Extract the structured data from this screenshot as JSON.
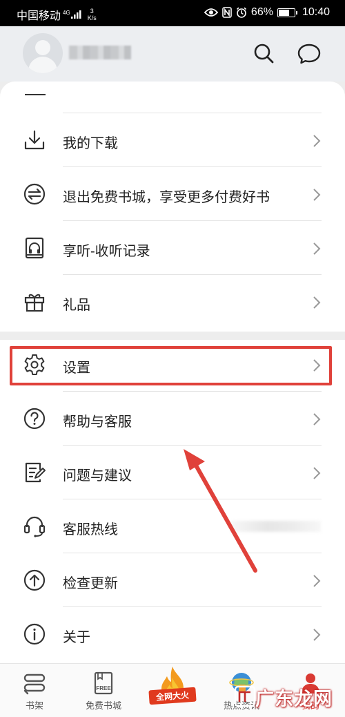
{
  "status_bar": {
    "carrier": "中国移动",
    "network": "4G",
    "speed_value": "3",
    "speed_unit": "K/s",
    "battery": "66%",
    "time": "10:40"
  },
  "header": {
    "icons": [
      "search-icon",
      "message-icon"
    ]
  },
  "menu": {
    "items": [
      {
        "label": "我的下载",
        "icon": "download-icon"
      },
      {
        "label": "退出免费书城，享受更多付费好书",
        "icon": "exchange-icon"
      },
      {
        "label": "享听-收听记录",
        "icon": "audiobook-icon"
      },
      {
        "label": "礼品",
        "icon": "gift-icon"
      },
      {
        "label": "设置",
        "icon": "gear-icon"
      },
      {
        "label": "帮助与客服",
        "icon": "help-icon"
      },
      {
        "label": "问题与建议",
        "icon": "feedback-icon"
      },
      {
        "label": "客服热线",
        "icon": "headset-icon"
      },
      {
        "label": "检查更新",
        "icon": "update-icon"
      },
      {
        "label": "关于",
        "icon": "info-icon"
      }
    ]
  },
  "bottom_nav": {
    "items": [
      {
        "label": "书架",
        "icon": "bookshelf-icon"
      },
      {
        "label": "免费书城",
        "icon": "free-book-icon",
        "icon_text": "FREE"
      },
      {
        "label": "",
        "icon": "fire-promo-icon",
        "promo_text": "全网大火"
      },
      {
        "label": "热点资讯",
        "icon": "globe-news-icon"
      },
      {
        "label": "我的",
        "icon": "profile-icon"
      }
    ]
  },
  "annotation": {
    "highlight_color": "#e0413a"
  },
  "watermark": {
    "text": "广东龙网"
  }
}
